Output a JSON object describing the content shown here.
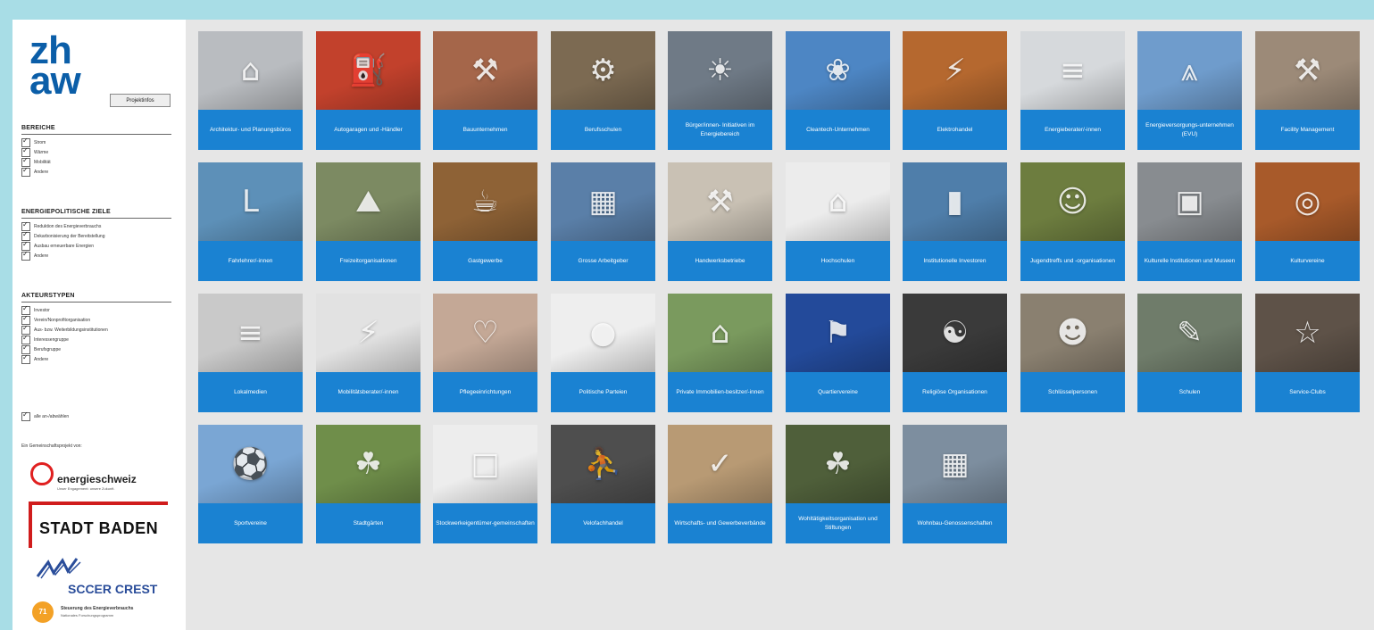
{
  "sidebar": {
    "logo_line1": "zh",
    "logo_line2": "aw",
    "project_button": "Projektinfos",
    "sections": [
      {
        "title": "BEREICHE",
        "items": [
          "Strom",
          "Wärme",
          "Mobilität",
          "Andere"
        ]
      },
      {
        "title": "ENERGIEPOLITISCHE ZIELE",
        "items": [
          "Reduktion des Energieverbrauchs",
          "Dekarbonisierung der Bereitstellung",
          "Ausbau erneuerbare Energien",
          "Andere"
        ]
      },
      {
        "title": "AKTEURSTYPEN",
        "items": [
          "Investor",
          "Verein/Nonprofitorganisation",
          "Aus- bzw. Weiterbildungsinstitutionen",
          "Interessengruppe",
          "Berufsgruppe",
          "Andere"
        ]
      }
    ],
    "select_all": "alle an-/abwählen",
    "partner_intro": "Ein Gemeinschaftsprojekt von:",
    "partners": {
      "energie_name": "energieschweiz",
      "energie_sub": "Unser Engagement: unsere Zukunft.",
      "baden": "STADT BADEN",
      "sccer": "SCCER CREST",
      "nfp_badge": "71",
      "nfp_line1": "Steuerung des Energieverbrauchs",
      "nfp_line2": "Nationales Forschungsprogramm"
    }
  },
  "tiles": [
    {
      "label": "Architektur- und Planungsbüros",
      "icon": "blueprint-icon",
      "bg": "#b9bcc0"
    },
    {
      "label": "Autogaragen und -Händler",
      "icon": "garage-sign-icon",
      "bg": "#c2412c"
    },
    {
      "label": "Bauunternehmen",
      "icon": "construction-worker-icon",
      "bg": "#a5664a"
    },
    {
      "label": "Berufsschulen",
      "icon": "workshop-icon",
      "bg": "#7c6a52"
    },
    {
      "label": "Bürger/innen- Initiativen im Energiebereich",
      "icon": "solar-roof-icon",
      "bg": "#6f7a86"
    },
    {
      "label": "Cleantech-Unternehmen",
      "icon": "wind-turbine-icon",
      "bg": "#4d86c4"
    },
    {
      "label": "Elektrohandel",
      "icon": "shop-icon",
      "bg": "#b5682f"
    },
    {
      "label": "Energieberater/-innen",
      "icon": "energy-label-icon",
      "bg": "#d6d9dc"
    },
    {
      "label": "Energieversorgungs-unternehmen (EVU)",
      "icon": "power-pylon-icon",
      "bg": "#6f9ccc"
    },
    {
      "label": "Facility Management",
      "icon": "technician-icon",
      "bg": "#9c8a78"
    },
    {
      "label": "Fahrlehrer/-innen",
      "icon": "learner-plate-icon",
      "bg": "#5d90b8"
    },
    {
      "label": "Freizeitorganisationen",
      "icon": "hiking-icon",
      "bg": "#7c8a62"
    },
    {
      "label": "Gastgewerbe",
      "icon": "restaurant-sign-icon",
      "bg": "#8e6236"
    },
    {
      "label": "Grosse Arbeitgeber",
      "icon": "office-building-icon",
      "bg": "#5a7fa8"
    },
    {
      "label": "Handwerksbetriebe",
      "icon": "craftsman-icon",
      "bg": "#c9c1b4"
    },
    {
      "label": "Hochschulen",
      "icon": "graduation-cap-icon",
      "bg": "#ececec"
    },
    {
      "label": "Institutionelle Investoren",
      "icon": "skyscraper-icon",
      "bg": "#4f7eaa"
    },
    {
      "label": "Jugendtreffs und -organisationen",
      "icon": "youth-group-icon",
      "bg": "#6d7d3f"
    },
    {
      "label": "Kulturelle Institutionen und Museen",
      "icon": "museum-icon",
      "bg": "#888c90"
    },
    {
      "label": "Kulturvereine",
      "icon": "paella-icon",
      "bg": "#a85a2a"
    },
    {
      "label": "Lokalmedien",
      "icon": "newspaper-icon",
      "bg": "#c9c9c9"
    },
    {
      "label": "Mobilitätsberater/-innen",
      "icon": "electric-car-icon",
      "bg": "#e2e2e2"
    },
    {
      "label": "Pflegeeinrichtungen",
      "icon": "elderly-care-icon",
      "bg": "#c4a896"
    },
    {
      "label": "Politische Parteien",
      "icon": "party-figures-icon",
      "bg": "#eeeeee"
    },
    {
      "label": "Private Immobilien-besitzer/-innen",
      "icon": "house-icon",
      "bg": "#7a9a5e"
    },
    {
      "label": "Quartiervereine",
      "icon": "neighborhood-icon",
      "bg": "#234a9a"
    },
    {
      "label": "Religiöse Organisationen",
      "icon": "religion-symbols-icon",
      "bg": "#3a3a3a"
    },
    {
      "label": "Schlüsselpersonen",
      "icon": "conference-icon",
      "bg": "#8a8070"
    },
    {
      "label": "Schulen",
      "icon": "classroom-icon",
      "bg": "#6f7c6a"
    },
    {
      "label": "Service-Clubs",
      "icon": "event-icon",
      "bg": "#5e5248"
    },
    {
      "label": "Sportvereine",
      "icon": "football-icon",
      "bg": "#7aa6d4"
    },
    {
      "label": "Stadtgärten",
      "icon": "garden-icon",
      "bg": "#6f8e4a"
    },
    {
      "label": "Stockwerkeigentümer-gemeinschaften",
      "icon": "floor-plan-icon",
      "bg": "#ededed"
    },
    {
      "label": "Velofachhandel",
      "icon": "bicycle-icon",
      "bg": "#4e4e4e"
    },
    {
      "label": "Wirtschafts- und Gewerbeverbände",
      "icon": "open-sign-icon",
      "bg": "#b89a74"
    },
    {
      "label": "Wohltätigkeitsorganisation und Stiftungen",
      "icon": "seedling-icon",
      "bg": "#4f5f3a"
    },
    {
      "label": "Wohnbau-Genossenschaften",
      "icon": "apartment-icon",
      "bg": "#7d8e9f"
    }
  ]
}
